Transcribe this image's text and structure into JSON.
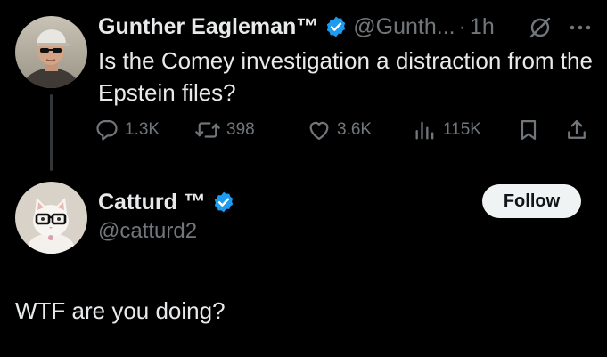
{
  "colors": {
    "background": "#000000",
    "primary_text": "#e7e9ea",
    "secondary_text": "#71767b",
    "verified_blue": "#1d9bf0",
    "follow_button_bg": "#eff3f4",
    "follow_button_text": "#0f1419",
    "thread_line": "#333639"
  },
  "parent_tweet": {
    "author_name": "Gunther Eagleman™",
    "handle": "@Gunth...",
    "separator": "·",
    "time": "1h",
    "verified": true,
    "text": "Is the Comey investigation a distraction from the Epstein files?",
    "actions": {
      "replies": "1.3K",
      "reposts": "398",
      "likes": "3.6K",
      "views": "115K"
    },
    "icons": [
      "grok-icon",
      "more-icon",
      "reply-icon",
      "repost-icon",
      "like-icon",
      "views-icon",
      "bookmark-icon",
      "share-icon"
    ]
  },
  "reply_tweet": {
    "author_name": "Catturd ™",
    "handle": "@catturd2",
    "verified": true,
    "follow_label": "Follow",
    "text": "WTF are you doing?"
  }
}
